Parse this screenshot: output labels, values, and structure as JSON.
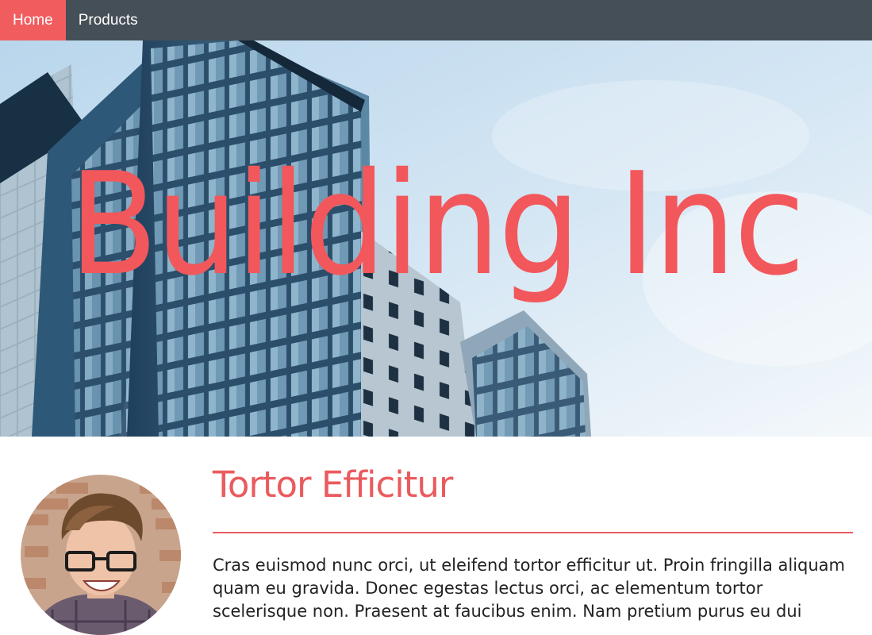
{
  "nav": {
    "items": [
      {
        "label": "Home",
        "active": true
      },
      {
        "label": "Products",
        "active": false
      }
    ],
    "background": "#454f57",
    "active_background": "#f15d5f"
  },
  "hero": {
    "title": "Building Inc",
    "title_color": "#f2575b",
    "image": "building-photo"
  },
  "article": {
    "title": "Tortor Efficitur",
    "accent_color": "#ea5b5e",
    "body": "Cras euismod nunc orci, ut eleifend tortor efficitur ut. Proin fringilla aliquam quam eu gravida. Donec egestas lectus orci, ac elementum tortor scelerisque non. Praesent at faucibus enim. Nam pretium purus eu dui",
    "avatar": "person-photo"
  }
}
